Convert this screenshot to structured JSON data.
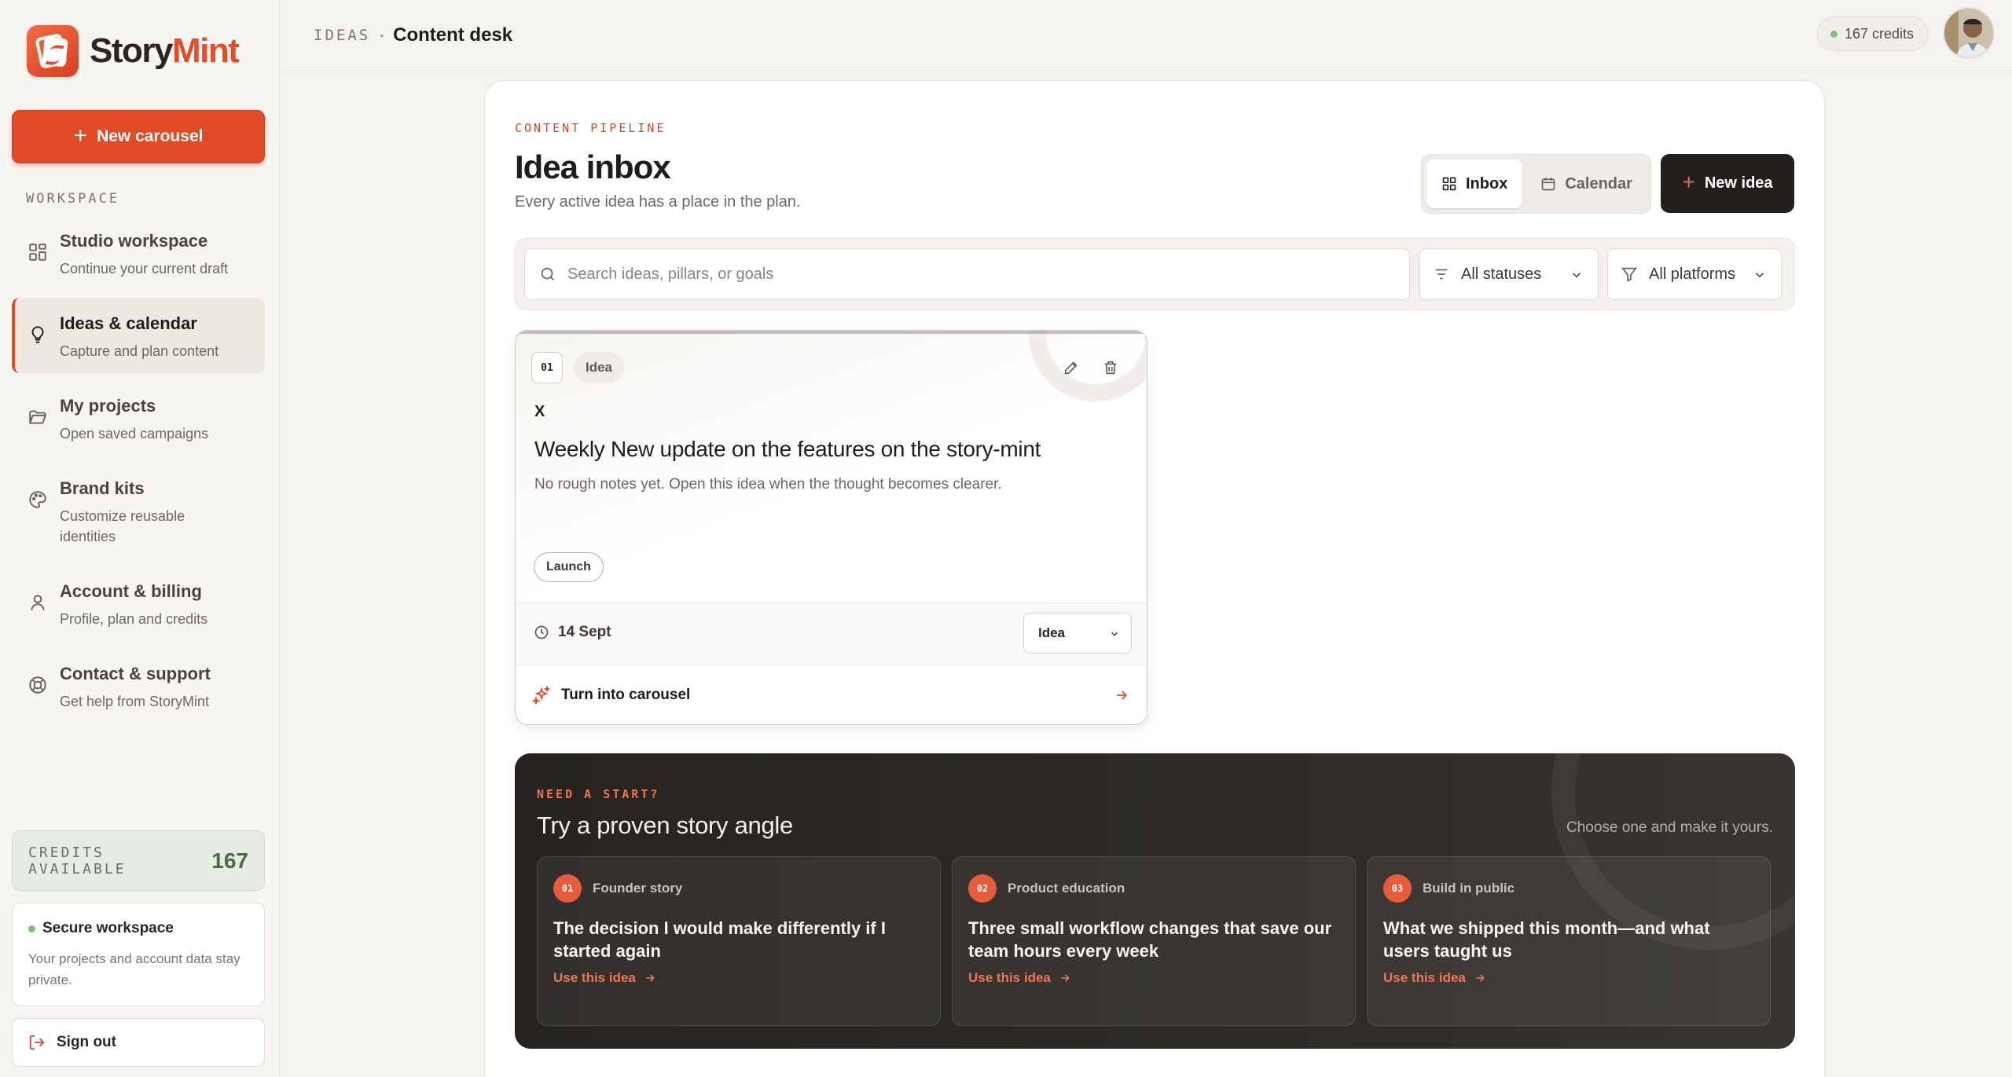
{
  "brand": {
    "name_part1": "Story",
    "name_part2": "Mint",
    "accent": "#e04b28"
  },
  "sidebar": {
    "new_carousel_label": "New carousel",
    "section_label": "WORKSPACE",
    "items": [
      {
        "title": "Studio workspace",
        "subtitle": "Continue your current draft",
        "icon": "grid-icon"
      },
      {
        "title": "Ideas & calendar",
        "subtitle": "Capture and plan content",
        "icon": "lightbulb-icon"
      },
      {
        "title": "My projects",
        "subtitle": "Open saved campaigns",
        "icon": "folder-icon"
      },
      {
        "title": "Brand kits",
        "subtitle": "Customize reusable identities",
        "icon": "palette-icon"
      },
      {
        "title": "Account & billing",
        "subtitle": "Profile, plan and credits",
        "icon": "user-icon"
      },
      {
        "title": "Contact & support",
        "subtitle": "Get help from StoryMint",
        "icon": "lifebuoy-icon"
      }
    ],
    "credits_label": "CREDITS AVAILABLE",
    "credits_value": "167",
    "secure_title": "Secure workspace",
    "secure_text": "Your projects and account data stay private.",
    "signout_label": "Sign out"
  },
  "header": {
    "crumb_section": "IDEAS",
    "crumb_page": "Content desk",
    "credits_pill": "167 credits"
  },
  "main": {
    "eyebrow": "CONTENT PIPELINE",
    "title": "Idea inbox",
    "subtitle": "Every active idea has a place in the plan.",
    "view_tabs": [
      {
        "label": "Inbox",
        "active": true
      },
      {
        "label": "Calendar",
        "active": false
      }
    ],
    "new_idea_label": "New idea",
    "search_placeholder": "Search ideas, pillars, or goals",
    "status_filter": "All statuses",
    "platform_filter": "All platforms"
  },
  "idea_card": {
    "number": "01",
    "type": "Idea",
    "platform_mark": "X",
    "title": "Weekly New update on the features on the story-mint",
    "notes": "No rough notes yet. Open this idea when the thought becomes clearer.",
    "tag": "Launch",
    "date": "14 Sept",
    "status": "Idea",
    "cta": "Turn into carousel"
  },
  "starter": {
    "eyebrow": "NEED A START?",
    "title": "Try a proven story angle",
    "hint": "Choose one and make it yours.",
    "angles": [
      {
        "num": "01",
        "category": "Founder story",
        "title": "The decision I would make differently if I started again",
        "link": "Use this idea"
      },
      {
        "num": "02",
        "category": "Product education",
        "title": "Three small workflow changes that save our team hours every week",
        "link": "Use this idea"
      },
      {
        "num": "03",
        "category": "Build in public",
        "title": "What we shipped this month—and what users taught us",
        "link": "Use this idea"
      }
    ]
  }
}
